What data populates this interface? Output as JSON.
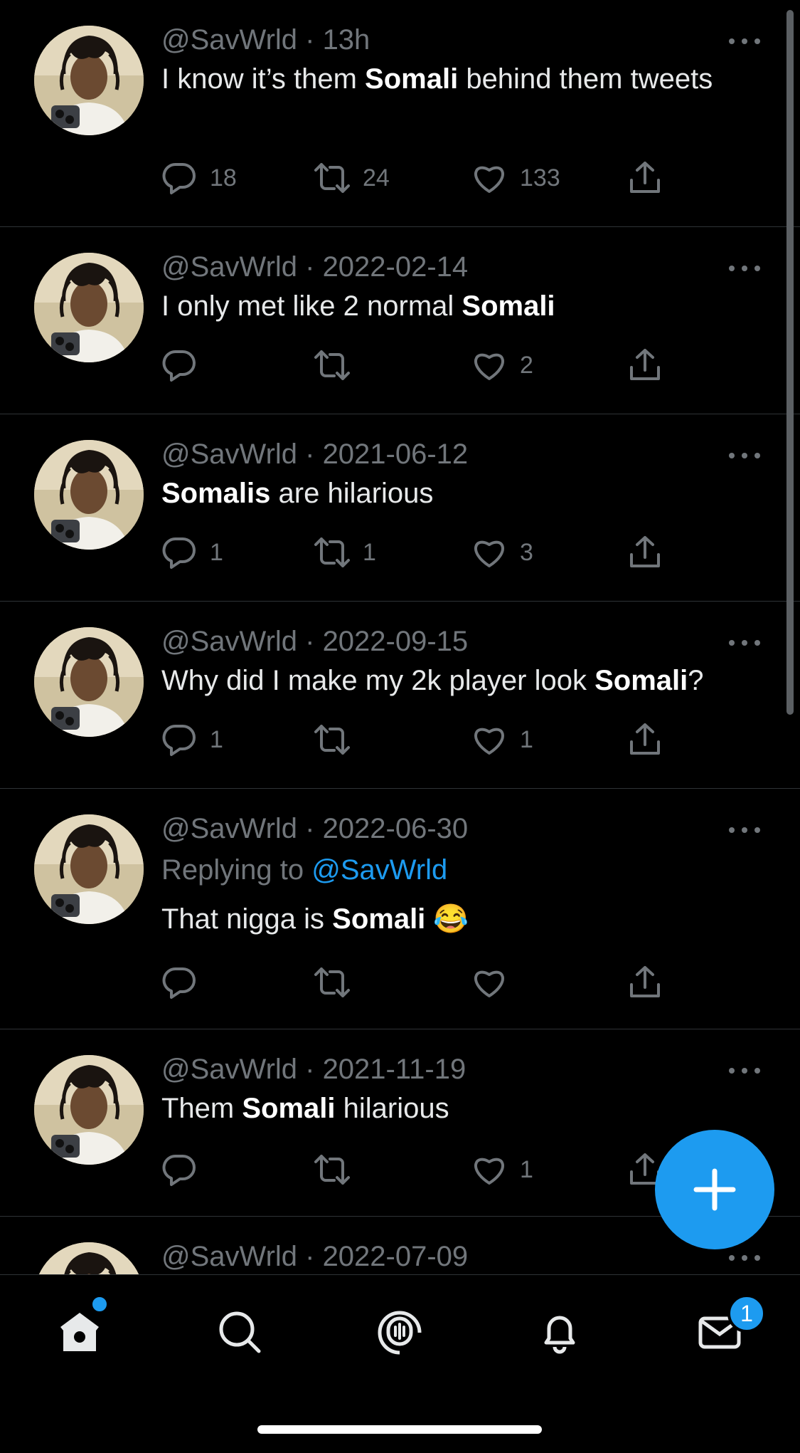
{
  "tweets": [
    {
      "handle": "@SavWrld",
      "sep": " · ",
      "time": "13h",
      "text": [
        {
          "t": "I know it’s them "
        },
        {
          "t": "Somali",
          "b": true
        },
        {
          "t": " behind them tweets"
        }
      ],
      "replies": "18",
      "retweets": "24",
      "likes": "133"
    },
    {
      "handle": "@SavWrld",
      "sep": " · ",
      "time": "2022-02-14",
      "text": [
        {
          "t": "I only met like 2 normal "
        },
        {
          "t": "Somali",
          "b": true
        }
      ],
      "replies": "",
      "retweets": "",
      "likes": "2"
    },
    {
      "handle": "@SavWrld",
      "sep": " · ",
      "time": "2021-06-12",
      "text": [
        {
          "t": "Somalis",
          "b": true
        },
        {
          "t": " are hilarious"
        }
      ],
      "replies": "1",
      "retweets": "1",
      "likes": "3"
    },
    {
      "handle": "@SavWrld",
      "sep": " · ",
      "time": "2022-09-15",
      "text": [
        {
          "t": "Why did I make my 2k player look "
        },
        {
          "t": "Somali",
          "b": true
        },
        {
          "t": "?"
        }
      ],
      "replies": "1",
      "retweets": "",
      "likes": "1"
    },
    {
      "handle": "@SavWrld",
      "sep": " · ",
      "time": "2022-06-30",
      "replying_prefix": "Replying to ",
      "replying_to": "@SavWrld",
      "text": [
        {
          "t": "That nigga is "
        },
        {
          "t": "Somali",
          "b": true
        },
        {
          "t": " 😂"
        }
      ],
      "replies": "",
      "retweets": "",
      "likes": ""
    },
    {
      "handle": "@SavWrld",
      "sep": " · ",
      "time": "2021-11-19",
      "text": [
        {
          "t": "Them "
        },
        {
          "t": "Somali",
          "b": true
        },
        {
          "t": " hilarious"
        }
      ],
      "replies": "",
      "retweets": "",
      "likes": "1"
    },
    {
      "handle": "@SavWrld",
      "sep": " · ",
      "time": "2022-07-09",
      "text": [],
      "replies": "",
      "retweets": "",
      "likes": ""
    }
  ],
  "nav": {
    "tabs": [
      "home",
      "search",
      "spaces",
      "notifications",
      "messages"
    ],
    "messages_badge": "1"
  },
  "colors": {
    "accent": "#1d9bf0",
    "background": "#000000",
    "muted": "#71767b"
  },
  "icons": {
    "compose": "plus-icon",
    "reply": "reply-icon",
    "retweet": "retweet-icon",
    "like": "heart-icon",
    "share": "share-icon",
    "more": "more-icon"
  }
}
